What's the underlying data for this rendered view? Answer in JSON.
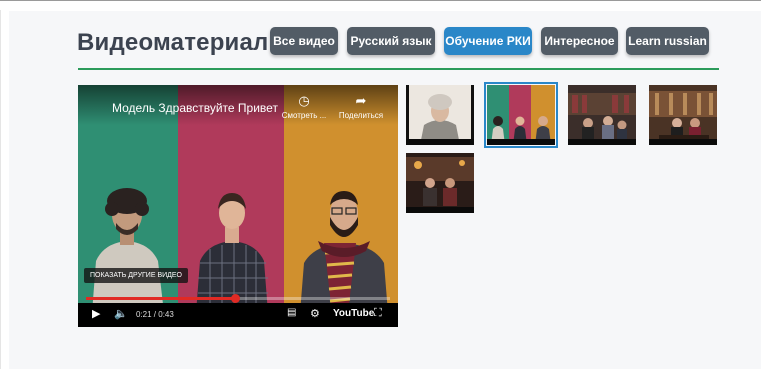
{
  "page": {
    "title": "Видеоматериалы"
  },
  "tabs": [
    {
      "label": "Все видео",
      "active": false
    },
    {
      "label": "Русский язык",
      "active": false
    },
    {
      "label": "Обучение РКИ",
      "active": true
    },
    {
      "label": "Интересное",
      "active": false
    },
    {
      "label": "Learn russian",
      "active": false
    }
  ],
  "colors": {
    "tab": "#525c66",
    "tab_active": "#2a87c8",
    "divider": "#2c9b5b",
    "progress": "#e12a24"
  },
  "player": {
    "video_title": "Модель Здравствуйте Привет",
    "watch_later_label": "Смотреть ...",
    "share_label": "Поделиться",
    "more_videos_label": "ПОКАЗАТЬ ДРУГИЕ ВИДЕО",
    "time": "0:21 / 0:43",
    "progress_fraction": 0.49,
    "brand": "YouTube",
    "icons": [
      "clock-icon",
      "share-icon",
      "play-icon",
      "volume-icon",
      "subtitles-icon",
      "settings-icon",
      "fullscreen-icon"
    ]
  },
  "thumbnails": [
    {
      "name": "elderly-woman",
      "active": false
    },
    {
      "name": "three-people-colored",
      "active": true
    },
    {
      "name": "library-group",
      "active": false
    },
    {
      "name": "reading-room",
      "active": false
    },
    {
      "name": "couple-evening",
      "active": false
    }
  ]
}
